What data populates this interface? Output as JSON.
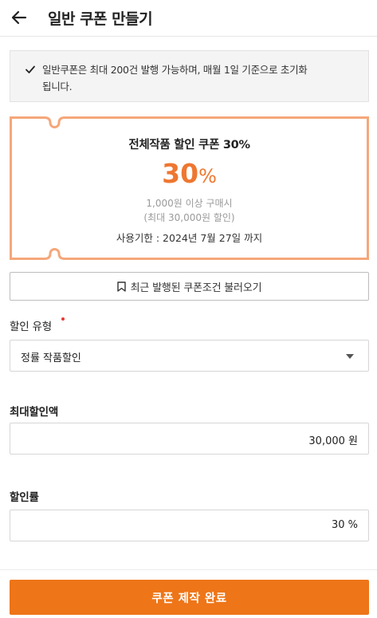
{
  "header": {
    "title": "일반 쿠폰 만들기",
    "back_icon": "arrow-left-icon"
  },
  "notice": {
    "icon": "check-icon",
    "line1": "일반쿠폰은 최대 200건 발행 가능하며, 매월 1일 기준으로 초기화",
    "line2": "됩니다."
  },
  "coupon": {
    "title": "전체작품 할인 쿠폰 30%",
    "rate_number": "30",
    "rate_unit": "%",
    "condition": "1,000원 이상 구매시",
    "max_discount": "(최대 30,000원 할인)",
    "expiry": "사용기한 : 2024년 7월 27일 까지",
    "border_color": "#f5a77a",
    "accent_color": "#ee7730"
  },
  "load_button": {
    "label": "최근 발행된 쿠폰조건 불러오기",
    "icon": "bookmark-icon"
  },
  "discount_type": {
    "label": "할인 유형",
    "value": "정률 작품할인",
    "required": true
  },
  "max_amount": {
    "label": "최대할인액",
    "value": "30,000 원"
  },
  "discount_rate": {
    "label": "할인률",
    "value": "30 %"
  },
  "submit": {
    "label": "쿠폰 제작 완료",
    "color": "#ee7518"
  }
}
